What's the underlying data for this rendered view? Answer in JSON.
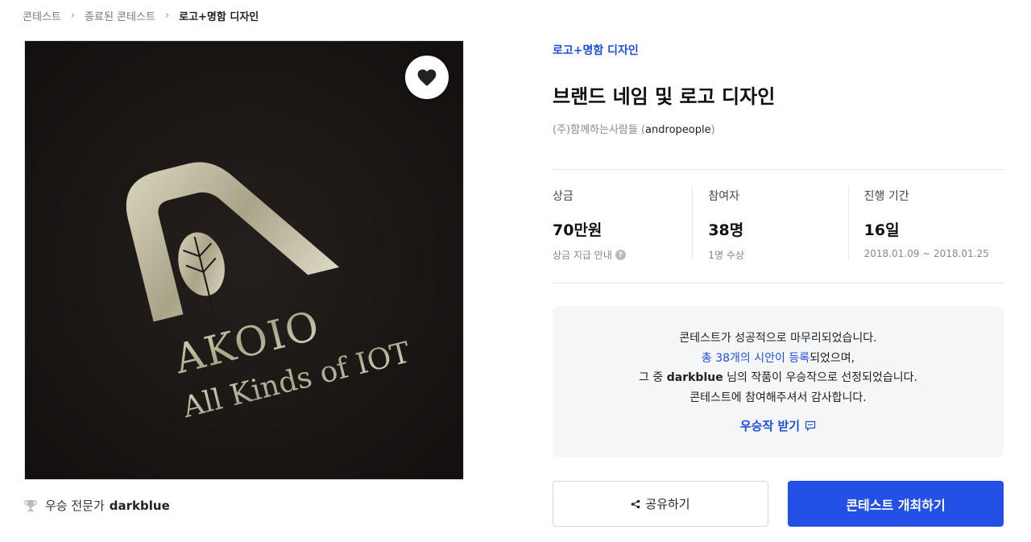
{
  "breadcrumb": [
    "콘테스트",
    "종료된 콘테스트",
    "로고+명함 디자인"
  ],
  "image": {
    "brand_text": "AKOIO",
    "tagline": "All Kinds of IOT"
  },
  "winner": {
    "label": "우승 전문가",
    "name": "darkblue"
  },
  "contest": {
    "category": "로고+명함 디자인",
    "title": "브랜드 네임 및 로고 디자인",
    "host_company": "(주)함께하는사람들",
    "host_id": "andropeople"
  },
  "stats": [
    {
      "label": "상금",
      "value": "70만원",
      "sub": "상금 지급 안내",
      "help": "?"
    },
    {
      "label": "참여자",
      "value": "38명",
      "sub": "1명 수상"
    },
    {
      "label": "진행 기간",
      "value": "16일",
      "sub": "2018.01.09 ~ 2018.01.25"
    }
  ],
  "notice": {
    "line1": "콘테스트가 성공적으로 마무리되었습니다.",
    "line2_link": "총 38개의 시안이 등록",
    "line2_rest": "되었으며,",
    "line3_pre": "그 중",
    "line3_name": "darkblue",
    "line3_post": "님의 작품이 우승작으로 선정되었습니다.",
    "line4": "콘테스트에 참여해주셔서 감사합니다.",
    "receive_label": "우승작 받기"
  },
  "buttons": {
    "share": "공유하기",
    "host": "콘테스트 개최하기"
  },
  "colors": {
    "accent": "#1e4fd8",
    "primary_button": "#2451e5",
    "image_bg": "#1b1715",
    "gold": "#c9c3a6"
  }
}
